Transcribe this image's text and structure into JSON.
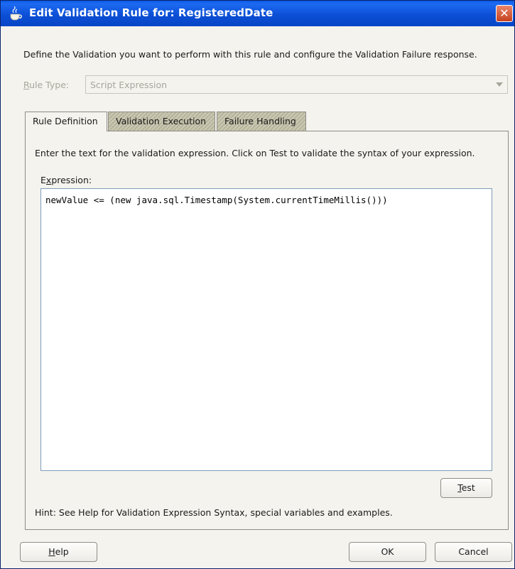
{
  "window": {
    "title": "Edit Validation Rule for: RegisteredDate",
    "close_glyph": "✕",
    "icon": "coffee-cup-icon",
    "title_bar_color": "#0c4fd6"
  },
  "description": "Define the Validation you want to perform with this rule and configure the Validation Failure response.",
  "rule_type": {
    "label_mnemonic": "R",
    "label_rest": "ule Type:",
    "value": "Script Expression"
  },
  "tabs": [
    {
      "label": "Rule Definition",
      "active": true
    },
    {
      "label": "Validation Execution",
      "active": false
    },
    {
      "label": "Failure Handling",
      "active": false
    }
  ],
  "rule_definition": {
    "instructions": "Enter the text for the validation expression. Click on Test to validate the syntax of your expression.",
    "expression_label_first": "E",
    "expression_label_mnemonic": "x",
    "expression_label_rest": "pression:",
    "expression_value": "newValue <= (new java.sql.Timestamp(System.currentTimeMillis()))",
    "test_mnemonic": "T",
    "test_rest": "est",
    "hint": "Hint: See Help for Validation Expression Syntax, special variables and examples."
  },
  "footer": {
    "help_mnemonic": "H",
    "help_rest": "elp",
    "ok_label": "OK",
    "cancel_label": "Cancel"
  }
}
